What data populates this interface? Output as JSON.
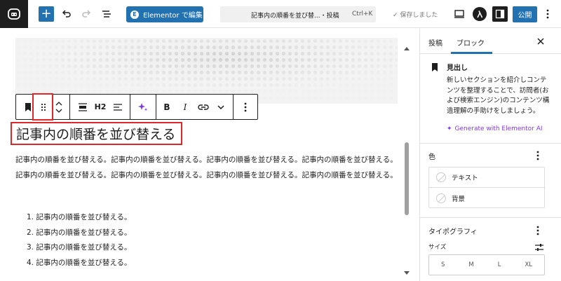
{
  "topbar": {
    "elementor_label": "Elementor で編集",
    "command_title": "記事内の順番を並び替...・投稿",
    "command_shortcut": "Ctrl+K",
    "saved_label": "✓ 保存しました",
    "publish_label": "公開"
  },
  "toolbar": {
    "heading_level": "H2"
  },
  "content": {
    "heading": "記事内の順番を並び替える",
    "paragraph": "記事内の順番を並び替える。記事内の順番を並び替える。記事内の順番を並び替える。記事内の順番を並び替える。記事内の順番を並び替える。記事内の順番を並び替える。記事内の順番を並び替える。記事内の順番を並び替える。",
    "list": [
      "1. 記事内の順番を並び替える。",
      "2. 記事内の順番を並び替える。",
      "3. 記事内の順番を並び替える。",
      "4. 記事内の順番を並び替える。"
    ]
  },
  "sidebar": {
    "tab_post": "投稿",
    "tab_block": "ブロック",
    "block_title": "見出し",
    "block_description": "新しいセクションを紹介しコンテンツを整理することで、訪問者(および検索エンジン)のコンテンツ構造理解の手助けをしましょう。",
    "ai_link": "Generate with Elementor AI",
    "color_heading": "色",
    "color_text": "テキスト",
    "color_background": "背景",
    "typography_heading": "タイポグラフィ",
    "size_label": "サイズ",
    "sizes": {
      "s": "S",
      "m": "M",
      "l": "L",
      "xl": "XL"
    }
  },
  "colors": {
    "accent": "#2271b1",
    "highlight": "#e02828",
    "ai_purple": "#7c3aed"
  }
}
